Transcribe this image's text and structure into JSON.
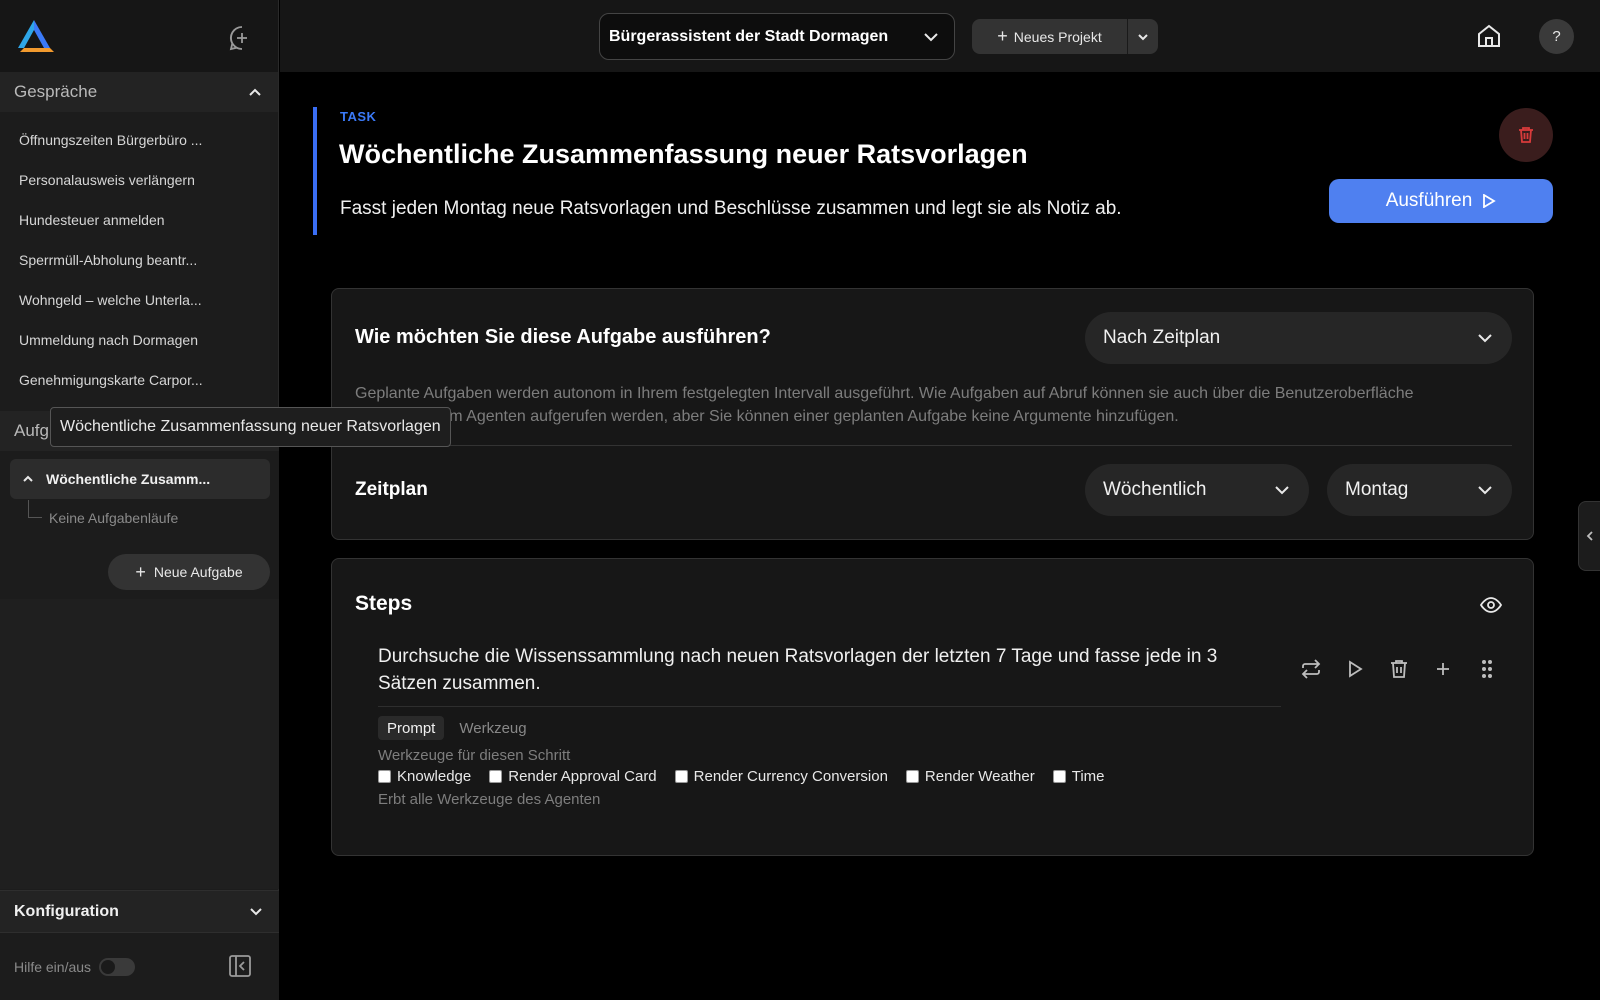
{
  "sidebar": {
    "conversations_header": "Gespräche",
    "conversations": [
      "Öffnungszeiten Bürgerbüro ...",
      "Personalausweis verlängern",
      "Hundesteuer anmelden",
      "Sperrmüll-Abholung beantr...",
      "Wohngeld – welche Unterla...",
      "Ummeldung nach Dormagen",
      "Genehmigungskarte Carpor..."
    ],
    "tasks_header": "Aufg",
    "task_item": "Wöchentliche Zusamm...",
    "task_runs": "Keine Aufgabenläufe",
    "new_task": "Neue Aufgabe",
    "config_header": "Konfiguration",
    "help_toggle": "Hilfe ein/aus"
  },
  "tooltip": "Wöchentliche Zusammenfassung neuer Ratsvorlagen",
  "topbar": {
    "project": "Bürgerassistent der Stadt Dormagen",
    "new_project": "Neues Projekt",
    "help": "?"
  },
  "task": {
    "tag": "TASK",
    "title": "Wöchentliche Zusammenfassung neuer Ratsvorlagen",
    "description": "Fasst jeden Montag neue Ratsvorlagen und Beschlüsse zusammen und legt sie als Notiz ab.",
    "run_label": "Ausführen"
  },
  "execution": {
    "question": "Wie möchten Sie diese Aufgabe ausführen?",
    "mode": "Nach Zeitplan",
    "help": "Geplante Aufgaben werden autonom in Ihrem festgelegten Intervall ausgeführt. Wie Aufgaben auf Abruf können sie auch über die Benutzeroberfläche oder von Ihrem Agenten aufgerufen werden, aber Sie können einer geplanten Aufgabe keine Argumente hinzufügen.",
    "schedule_label": "Zeitplan",
    "frequency": "Wöchentlich",
    "day": "Montag"
  },
  "steps": {
    "header": "Steps",
    "step_text": "Durchsuche die Wissenssammlung nach neuen Ratsvorlagen der letzten 7 Tage und fasse jede in 3 Sätzen zusammen.",
    "tab_prompt": "Prompt",
    "tab_tool": "Werkzeug",
    "tools_label": "Werkzeuge für diesen Schritt",
    "tools": [
      "Knowledge",
      "Render Approval Card",
      "Render Currency Conversion",
      "Render Weather",
      "Time"
    ],
    "inherit_note": "Erbt alle Werkzeuge des Agenten"
  },
  "colors": {
    "accent": "#4f80f0",
    "tag": "#3b7af8",
    "delete": "#d93b3b"
  }
}
